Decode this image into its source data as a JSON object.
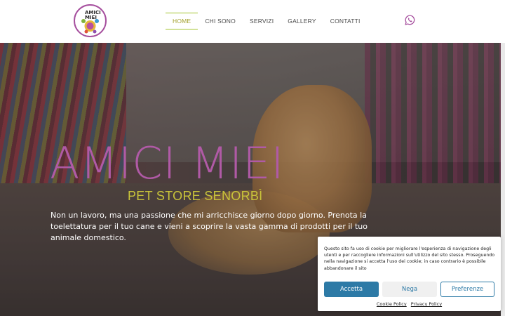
{
  "header": {
    "logo_line1": "AMICI",
    "logo_line2": "MIEI",
    "nav": [
      "HOME",
      "CHI SONO",
      "SERVIZI",
      "GALLERY",
      "CONTATTI"
    ],
    "active": "HOME",
    "whatsapp_icon": "whatsapp-icon"
  },
  "hero": {
    "title": "AMICI MIEI",
    "subtitle": "PET STORE SENORBÌ",
    "text": "Non un lavoro, ma una passione che mi arricchisce giorno dopo giorno. Prenota la toelettatura per il tuo cane e vieni a scoprire la vasta gamma di prodotti per il tuo animale domestico.",
    "title_color": "#b05aa6",
    "subtitle_color": "#c9c43a"
  },
  "cookie": {
    "text": "Questo sito fa uso di cookie per migliorare l'esperienza di navigazione degli utenti e per raccogliere informazioni sull'utilizzo del sito stesso. Proseguendo nella navigazione si accetta l'uso dei cookie; in caso contrario è possibile abbandonare il sito",
    "accept": "Accetta",
    "deny": "Nega",
    "preferences": "Preferenze",
    "cookie_policy": "Cookie Policy",
    "privacy_policy": "Privacy Policy",
    "accent": "#2d7aa6"
  }
}
